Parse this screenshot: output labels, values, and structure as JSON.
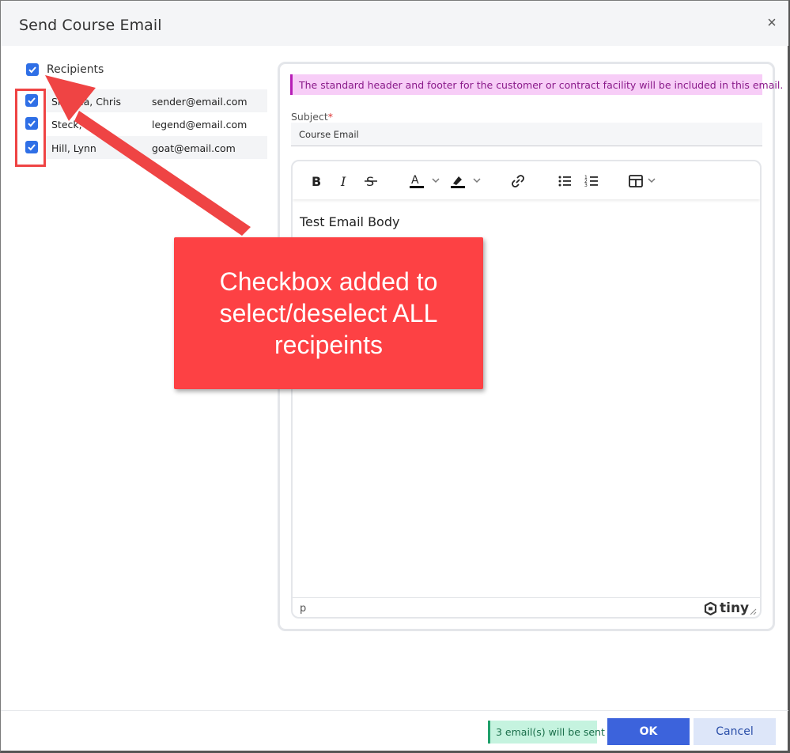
{
  "dialog": {
    "title": "Send Course Email",
    "close_glyph": "×"
  },
  "recipients": {
    "header_label": "Recipients",
    "all_checked": true,
    "rows": [
      {
        "name": "Sharma, Chris",
        "email": "sender@email.com",
        "checked": true
      },
      {
        "name": "Steck, Ue",
        "email": "legend@email.com",
        "checked": true
      },
      {
        "name": "Hill, Lynn",
        "email": "goat@email.com",
        "checked": true
      }
    ]
  },
  "notice": {
    "text": "The standard header and footer for the customer or contract facility will be included in this email."
  },
  "subject": {
    "label": "Subject",
    "required_mark": "*",
    "value": "Course Email"
  },
  "editor": {
    "toolbar": [
      "bold-icon",
      "italic-icon",
      "strikethrough-icon",
      "text-color-icon",
      "highlight-color-icon",
      "link-icon",
      "bullet-list-icon",
      "numbered-list-icon",
      "table-icon"
    ],
    "body": "Test Email Body",
    "status_path": "p",
    "brand": "tiny"
  },
  "callout": {
    "text": "Checkbox added to select/deselect ALL recipeints"
  },
  "footer": {
    "count_badge": "3 email(s) will be sent",
    "ok_label": "OK",
    "cancel_label": "Cancel"
  },
  "colors": {
    "accent": "#3c63dc",
    "checkbox": "#2f6fe6",
    "callout": "#fd4144",
    "notice_bg": "#f7cdf7",
    "badge_bg": "#c5f3df"
  }
}
